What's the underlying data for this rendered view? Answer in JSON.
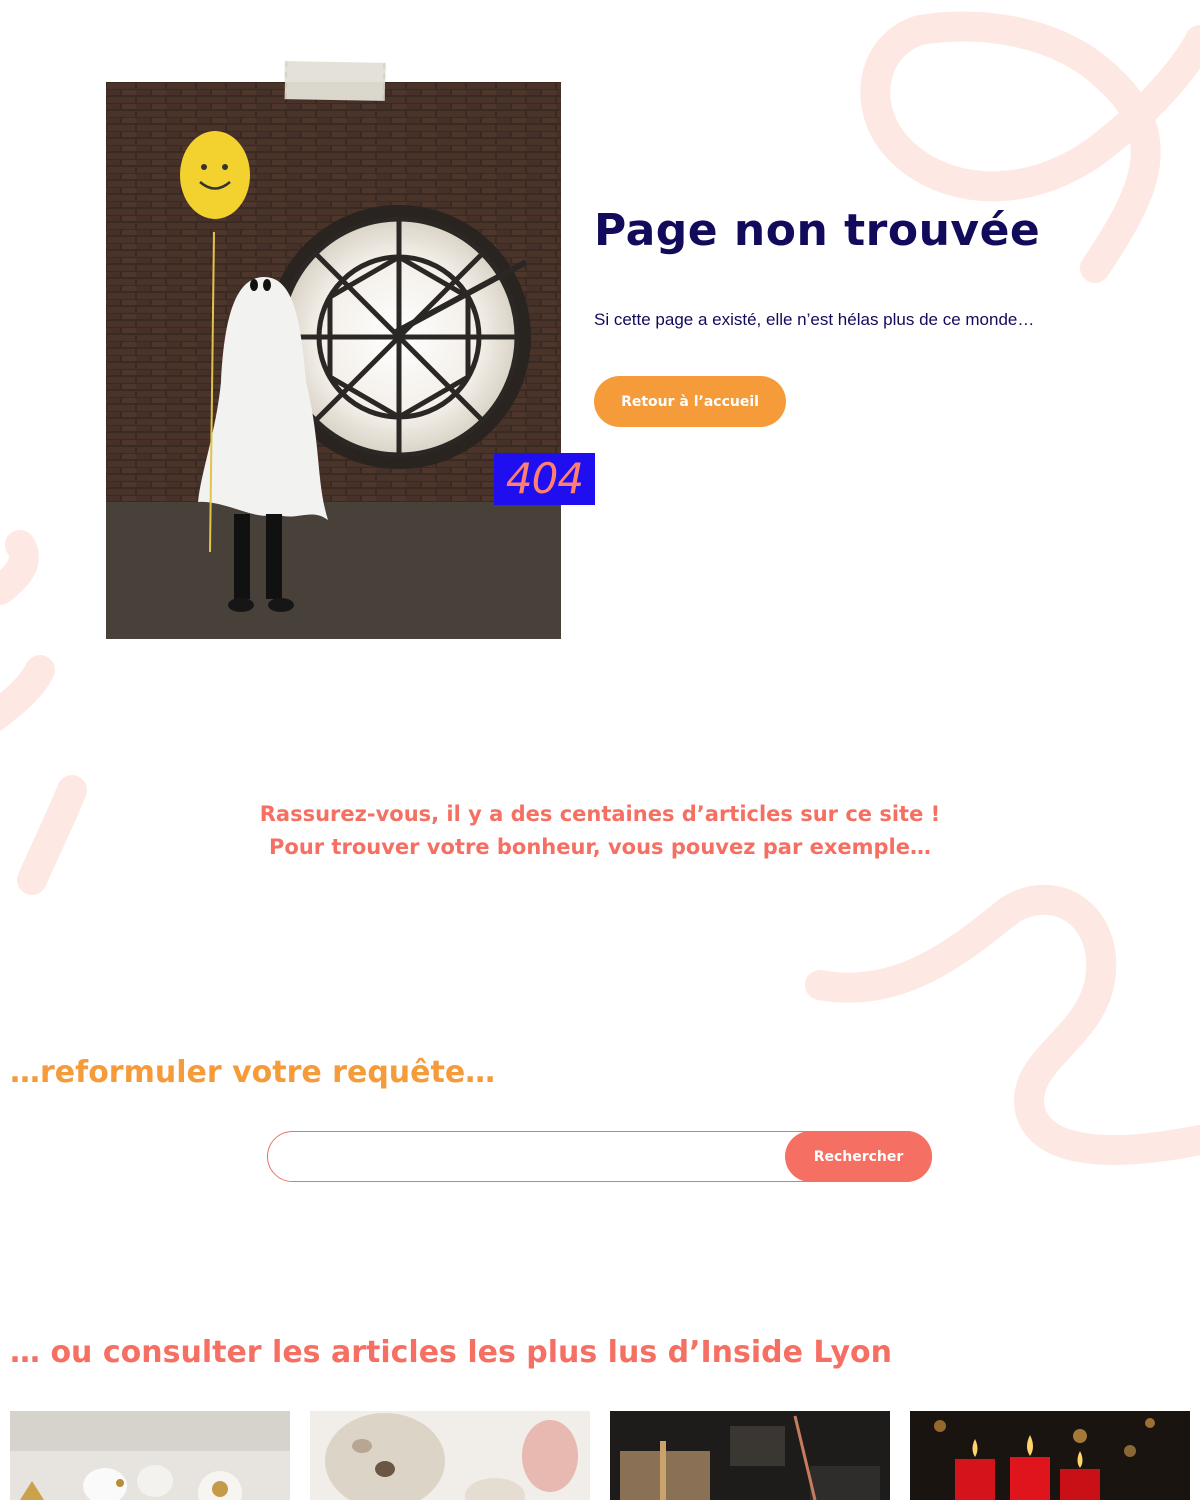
{
  "error": {
    "title": "Page non trouvée",
    "subtitle": "Si cette page a existé, elle n’est hélas plus de ce monde…",
    "badge": "404",
    "home_button": "Retour à l’accueil"
  },
  "reassure": {
    "line1": "Rassurez-vous, il y a des centaines d’articles sur ce site !",
    "line2": "Pour trouver votre bonheur, vous pouvez par exemple…"
  },
  "search": {
    "heading": "…reformuler votre requête…",
    "placeholder": "",
    "button": "Rechercher"
  },
  "popular": {
    "heading": "… ou consulter les articles les plus lus d’Inside Lyon",
    "cards": [
      {
        "image": "white-ceramic-decorations"
      },
      {
        "image": "plush-teddy-bears"
      },
      {
        "image": "wrapped-gift-boxes"
      },
      {
        "image": "red-candles-bokeh"
      }
    ]
  },
  "colors": {
    "navy": "#120b5c",
    "orange": "#f59b3a",
    "coral": "#f56f62",
    "blue_badge": "#1f0ef0",
    "deco_pink": "#fde8e3"
  },
  "images": {
    "hero": "ghost-costume-with-smiley-balloon-in-front-of-clock-window"
  }
}
